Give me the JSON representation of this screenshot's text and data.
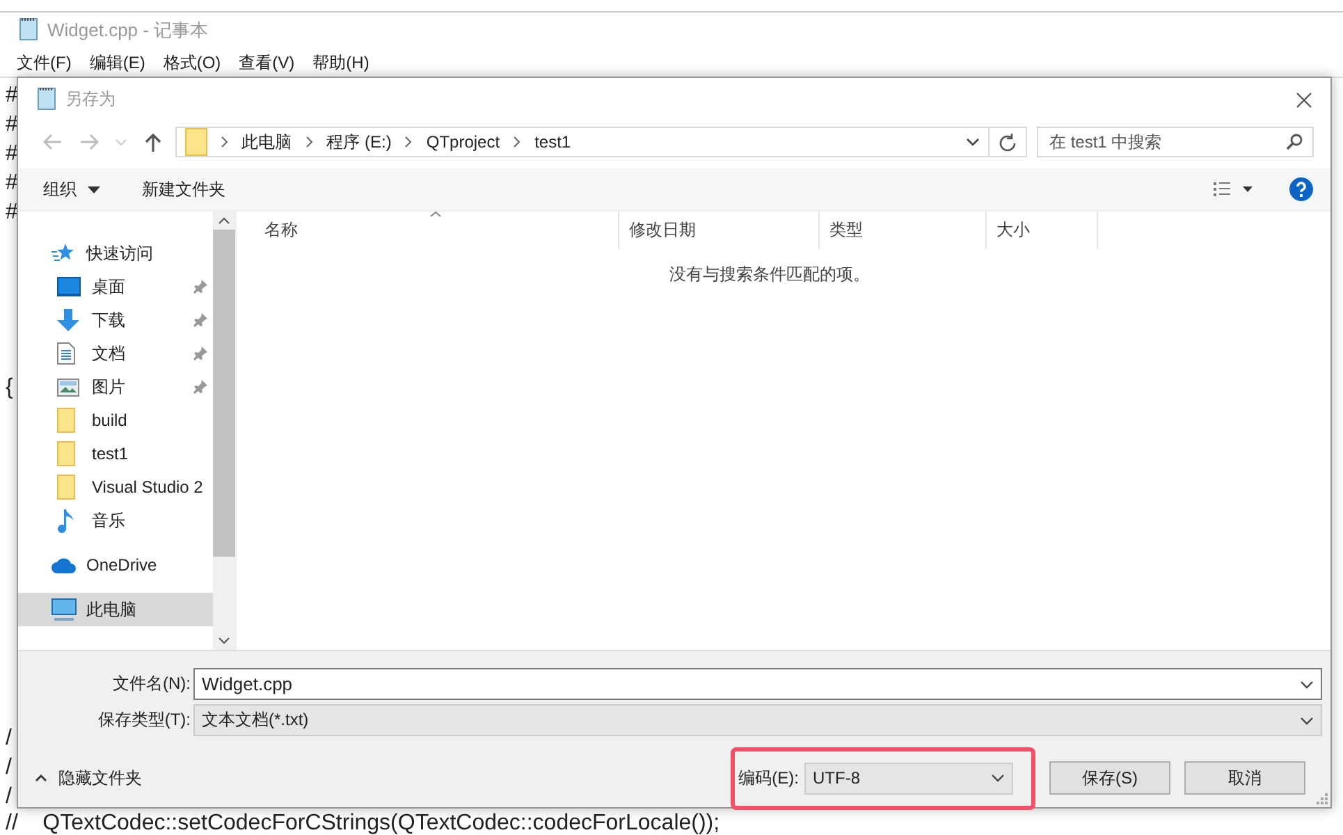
{
  "notepad": {
    "title": "Widget.cpp - 记事本",
    "menu": [
      "文件(F)",
      "编辑(E)",
      "格式(O)",
      "查看(V)",
      "帮助(H)"
    ],
    "editor_blocks": [
      {
        "lines": [
          "#",
          "#",
          "#",
          "#",
          "#"
        ]
      },
      {
        "lines": [
          "{"
        ]
      },
      {
        "lines": [
          "/",
          "/",
          "/",
          "//    QTextCodec::setCodecForCStrings(QTextCodec::codecForLocale());"
        ]
      }
    ]
  },
  "dialog": {
    "title": "另存为",
    "breadcrumb": [
      "此电脑",
      "程序 (E:)",
      "QTproject",
      "test1"
    ],
    "search": {
      "placeholder": "在 test1 中搜索"
    },
    "toolbar": {
      "organize": "组织",
      "new_folder": "新建文件夹"
    },
    "nav": [
      {
        "kind": "star",
        "label": "快速访问",
        "pinned": false,
        "selected": false,
        "indent": false
      },
      {
        "kind": "desktop",
        "label": "桌面",
        "pinned": true,
        "selected": false,
        "indent": true
      },
      {
        "kind": "download",
        "label": "下载",
        "pinned": true,
        "selected": false,
        "indent": true
      },
      {
        "kind": "document",
        "label": "文档",
        "pinned": true,
        "selected": false,
        "indent": true
      },
      {
        "kind": "picture",
        "label": "图片",
        "pinned": true,
        "selected": false,
        "indent": true
      },
      {
        "kind": "folder",
        "label": "build",
        "pinned": false,
        "selected": false,
        "indent": true
      },
      {
        "kind": "folder",
        "label": "test1",
        "pinned": false,
        "selected": false,
        "indent": true
      },
      {
        "kind": "folder",
        "label": "Visual Studio 2",
        "pinned": false,
        "selected": false,
        "indent": true
      },
      {
        "kind": "music",
        "label": "音乐",
        "pinned": false,
        "selected": false,
        "indent": true
      },
      {
        "kind": "cloud",
        "label": "OneDrive",
        "pinned": false,
        "selected": false,
        "indent": false
      },
      {
        "kind": "computer",
        "label": "此电脑",
        "pinned": false,
        "selected": true,
        "indent": false
      }
    ],
    "columns": [
      "名称",
      "修改日期",
      "类型",
      "大小"
    ],
    "empty_message": "没有与搜索条件匹配的项。",
    "filename": {
      "label": "文件名(N):",
      "value": "Widget.cpp"
    },
    "filetype": {
      "label": "保存类型(T):",
      "value": "文本文档(*.txt)"
    },
    "hide_folders": "隐藏文件夹",
    "encoding": {
      "label": "编码(E):",
      "value": "UTF-8",
      "highlighted": true
    },
    "buttons": [
      "保存(S)",
      "取消"
    ]
  }
}
